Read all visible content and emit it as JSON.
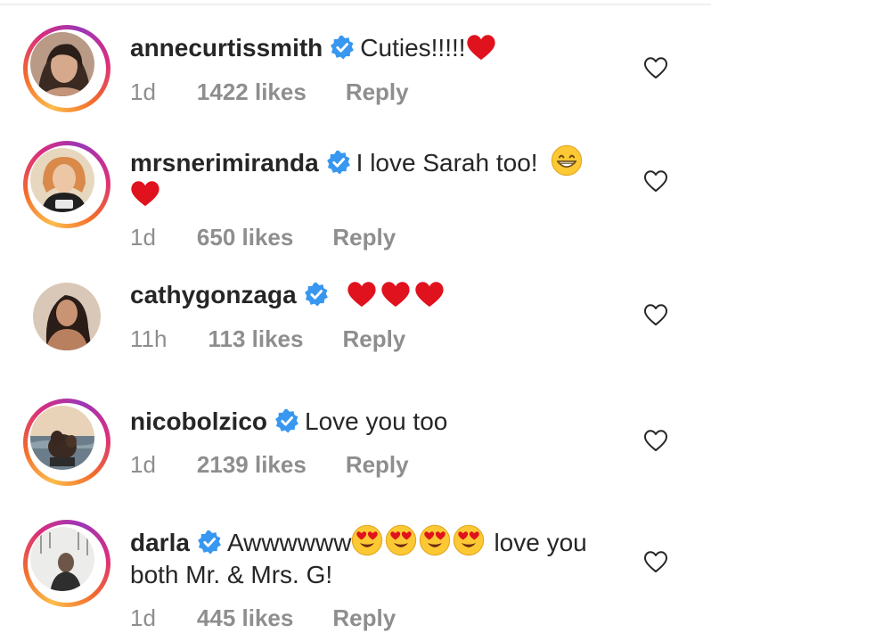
{
  "comments": [
    {
      "username": "annecurtissmith",
      "text": "Cuties!!!!!",
      "age": "1d",
      "likes": "1422 likes",
      "reply": "Reply"
    },
    {
      "username": "mrsnerimiranda",
      "text": "I love Sarah too!",
      "age": "1d",
      "likes": "650 likes",
      "reply": "Reply"
    },
    {
      "username": "cathygonzaga",
      "text": "",
      "age": "11h",
      "likes": "113 likes",
      "reply": "Reply"
    },
    {
      "username": "nicobolzico",
      "text": "Love you too",
      "age": "1d",
      "likes": "2139 likes",
      "reply": "Reply"
    },
    {
      "username": "darla",
      "text": "Awwwwww",
      "text_after": "love you",
      "text_line2": "both Mr. & Mrs. G!",
      "age": "1d",
      "likes": "445 likes",
      "reply": "Reply"
    }
  ],
  "icons": {
    "verified": "verified-badge-icon",
    "like": "heart-outline-icon",
    "red_heart": "red-heart-emoji",
    "grin": "grinning-face-emoji",
    "heart_eyes": "heart-eyes-emoji"
  },
  "colors": {
    "verified_blue": "#3897f0",
    "meta_gray": "#8e8e8e",
    "heart_red": "#e0121d"
  }
}
